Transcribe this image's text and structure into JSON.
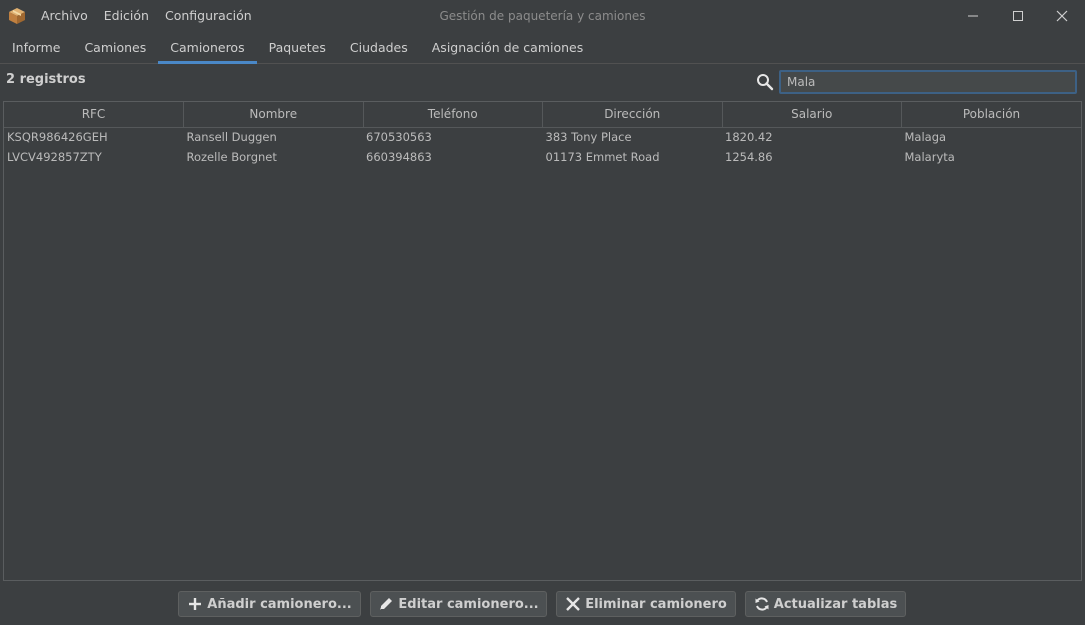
{
  "window": {
    "title": "Gestión de paquetería y camiones",
    "icon": "package-box-icon"
  },
  "menu": [
    "Archivo",
    "Edición",
    "Configuración"
  ],
  "tabs": [
    {
      "label": "Informe",
      "active": false
    },
    {
      "label": "Camiones",
      "active": false
    },
    {
      "label": "Camioneros",
      "active": true
    },
    {
      "label": "Paquetes",
      "active": false
    },
    {
      "label": "Ciudades",
      "active": false
    },
    {
      "label": "Asignación de camiones",
      "active": false
    }
  ],
  "records_label": "2 registros",
  "search": {
    "value": "Mala",
    "placeholder": ""
  },
  "table": {
    "columns": [
      "RFC",
      "Nombre",
      "Teléfono",
      "Dirección",
      "Salario",
      "Población"
    ],
    "rows": [
      [
        "KSQR986426GEH",
        "Ransell Duggen",
        "670530563",
        "383 Tony Place",
        "1820.42",
        "Malaga"
      ],
      [
        "LVCV492857ZTY",
        "Rozelle Borgnet",
        "660394863",
        "01173 Emmet Road",
        "1254.86",
        "Malaryta"
      ]
    ]
  },
  "buttons": {
    "add": "Añadir camionero...",
    "edit": "Editar camionero...",
    "delete": "Eliminar camionero",
    "refresh": "Actualizar tablas"
  },
  "colors": {
    "background": "#3c3f41",
    "accent": "#4a88c7",
    "text": "#bbbbbb"
  }
}
